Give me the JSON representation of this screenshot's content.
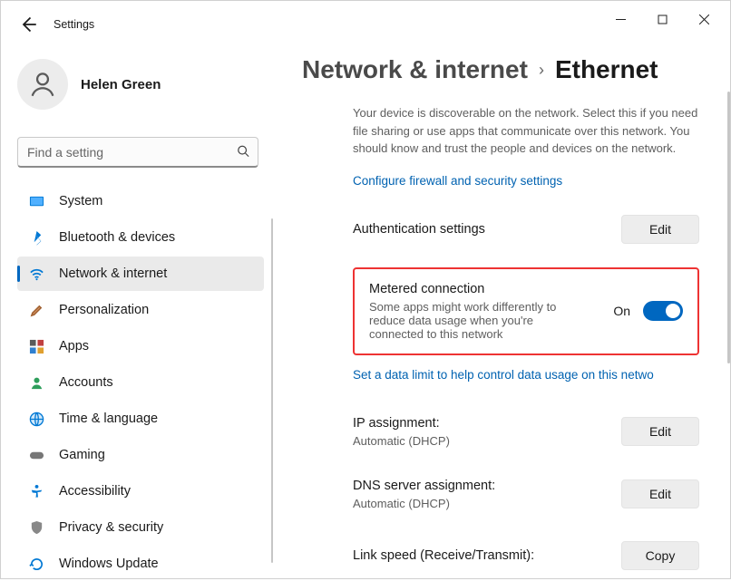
{
  "window": {
    "app_title": "Settings"
  },
  "user": {
    "name": "Helen Green"
  },
  "search": {
    "placeholder": "Find a setting"
  },
  "sidebar": {
    "items": [
      {
        "label": "System",
        "icon": "system"
      },
      {
        "label": "Bluetooth & devices",
        "icon": "bluetooth"
      },
      {
        "label": "Network & internet",
        "icon": "wifi",
        "selected": true
      },
      {
        "label": "Personalization",
        "icon": "brush"
      },
      {
        "label": "Apps",
        "icon": "apps"
      },
      {
        "label": "Accounts",
        "icon": "account"
      },
      {
        "label": "Time & language",
        "icon": "globe"
      },
      {
        "label": "Gaming",
        "icon": "gamepad"
      },
      {
        "label": "Accessibility",
        "icon": "accessibility"
      },
      {
        "label": "Privacy & security",
        "icon": "shield"
      },
      {
        "label": "Windows Update",
        "icon": "update"
      }
    ]
  },
  "breadcrumb": {
    "root": "Network & internet",
    "current": "Ethernet"
  },
  "discover": {
    "description": "Your device is discoverable on the network. Select this if you need file sharing or use apps that communicate over this network. You should know and trust the people and devices on the network.",
    "firewall_link": "Configure firewall and security settings"
  },
  "auth": {
    "title": "Authentication settings",
    "button": "Edit"
  },
  "metered": {
    "title": "Metered connection",
    "subtitle": "Some apps might work differently to reduce data usage when you're connected to this network",
    "state_label": "On",
    "state_on": true
  },
  "data_limit_link": "Set a data limit to help control data usage on this netwo",
  "ip": {
    "title": "IP assignment:",
    "value": "Automatic (DHCP)",
    "button": "Edit"
  },
  "dns": {
    "title": "DNS server assignment:",
    "value": "Automatic (DHCP)",
    "button": "Edit"
  },
  "linkspeed": {
    "title": "Link speed (Receive/Transmit):",
    "button": "Copy"
  }
}
